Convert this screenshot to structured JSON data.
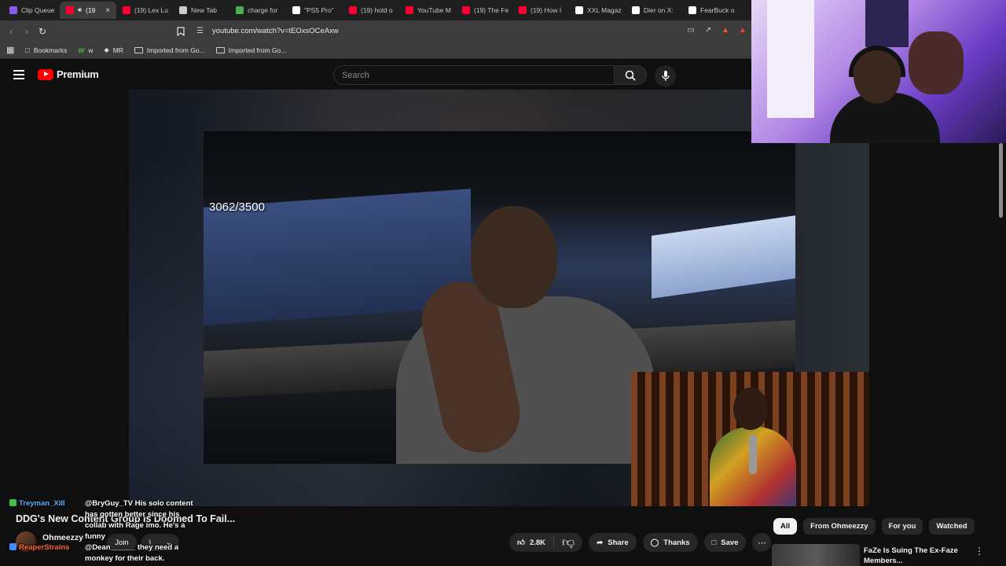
{
  "browser": {
    "tabs": [
      {
        "label": "Clip Queue",
        "color": "#8a5cf6"
      },
      {
        "label": "(19",
        "color": "#ff0033",
        "active": true
      },
      {
        "label": "(19) Lex Lu",
        "color": "#ff0033"
      },
      {
        "label": "New Tab",
        "color": "#cccccc"
      },
      {
        "label": "charge for",
        "color": "#4caf50"
      },
      {
        "label": "\"PS5 Pro\"",
        "color": "#ffffff"
      },
      {
        "label": "(19) hold o",
        "color": "#ff0033"
      },
      {
        "label": "YouTube M",
        "color": "#ff0033"
      },
      {
        "label": "(19) The Fe",
        "color": "#ff0033"
      },
      {
        "label": "(19) How I",
        "color": "#ff0033"
      },
      {
        "label": "XXL Magaz",
        "color": "#ffffff"
      },
      {
        "label": "Dier on X:",
        "color": "#ffffff"
      },
      {
        "label": "FearBuck o",
        "color": "#ffffff"
      }
    ],
    "url": "youtube.com/watch?v=tEOxsOCeAxw",
    "bookmarks": [
      {
        "label": "Bookmarks"
      },
      {
        "label": "w"
      },
      {
        "label": "MR"
      },
      {
        "label": "Imported from Go..."
      },
      {
        "label": "Imported from Go..."
      }
    ]
  },
  "youtube": {
    "logo_text": "Premium",
    "search_placeholder": "Search",
    "video_overlay_counter": "3062/3500",
    "video_title": "DDG's New Content Group Is Doomed To Fail...",
    "channel_name": "Ohmeezzy",
    "join_label": "Join",
    "likes": "2.8K",
    "share_label": "Share",
    "thanks_label": "Thanks",
    "save_label": "Save",
    "chips": [
      "All",
      "From Ohmeezzy",
      "For you",
      "Watched"
    ],
    "recommendation_title": "FaZe Is Suing The Ex-Faze Members..."
  },
  "chat": [
    {
      "user": "Treyman_XIII",
      "text": "@BryGuy_TV His solo content has gotten better since his collab with Rage imo. He's a funny",
      "color": "#5ab4ff"
    },
    {
      "user": "ReaperStrains",
      "text": "@Dean______ they need a monkey for their back.",
      "color": "#ff6a3a"
    }
  ]
}
